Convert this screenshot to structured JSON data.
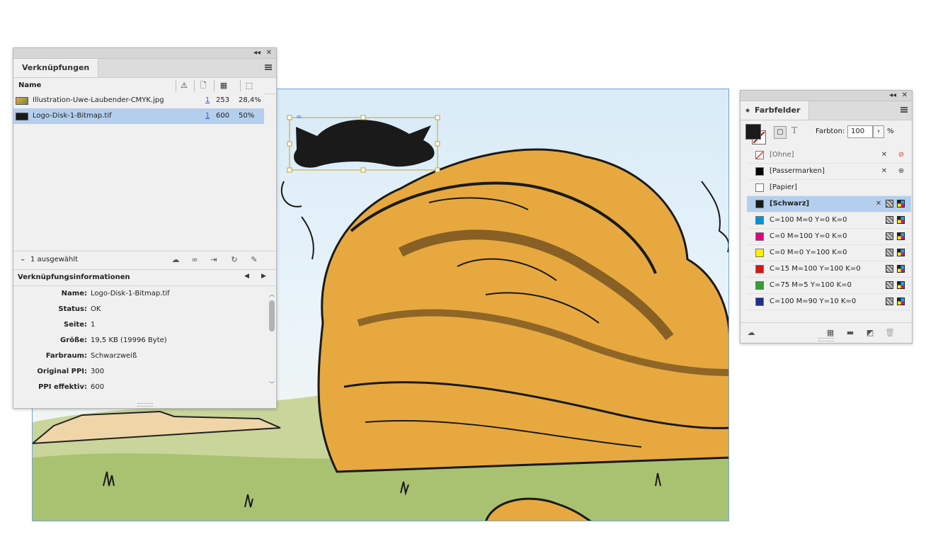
{
  "links_panel": {
    "title": "Verknüpfungen",
    "collapse_glyph": "◂◂",
    "close_glyph": "✕",
    "header": {
      "name_label": "Name"
    },
    "rows": [
      {
        "name": "Illustration-Uwe-Laubender-CMYK.jpg",
        "page": "1",
        "ppi": "253",
        "scale": "28,4%"
      },
      {
        "name": "Logo-Disk-1-Bitmap.tif",
        "page": "1",
        "ppi": "600",
        "scale": "50%"
      }
    ],
    "selection_status": "1 ausgewählt",
    "info_title": "Verknüpfungsinformationen",
    "info": [
      {
        "key": "Name:",
        "value": "Logo-Disk-1-Bitmap.tif"
      },
      {
        "key": "Status:",
        "value": "OK"
      },
      {
        "key": "Seite:",
        "value": "1"
      },
      {
        "key": "Größe:",
        "value": "19,5 KB (19996 Byte)"
      },
      {
        "key": "Farbraum:",
        "value": "Schwarzweiß"
      },
      {
        "key": "Original PPI:",
        "value": "300"
      },
      {
        "key": "PPI effektiv:",
        "value": "600"
      }
    ]
  },
  "swatches_panel": {
    "title": "Farbfelder",
    "tint_label": "Farbton:",
    "tint_value": "100",
    "tint_unit": "%",
    "swatches": [
      {
        "name": "[Ohne]",
        "color": "none"
      },
      {
        "name": "[Passermarken]",
        "color": "#000000"
      },
      {
        "name": "[Papier]",
        "color": "#ffffff"
      },
      {
        "name": "[Schwarz]",
        "color": "#1a1a1a",
        "selected": true
      },
      {
        "name": "C=100 M=0 Y=0 K=0",
        "color": "#0095d9"
      },
      {
        "name": "C=0 M=100 Y=0 K=0",
        "color": "#e4007f"
      },
      {
        "name": "C=0 M=0 Y=100 K=0",
        "color": "#fff000"
      },
      {
        "name": "C=15 M=100 Y=100 K=0",
        "color": "#d01919"
      },
      {
        "name": "C=75 M=5 Y=100 K=0",
        "color": "#3a9a3a"
      },
      {
        "name": "C=100 M=90 Y=10 K=0",
        "color": "#1f2e86"
      }
    ]
  },
  "colors": {
    "selection": "#b4cfee",
    "frame_handle": "#c9a21f",
    "rock_fill": "#e7a93f"
  }
}
